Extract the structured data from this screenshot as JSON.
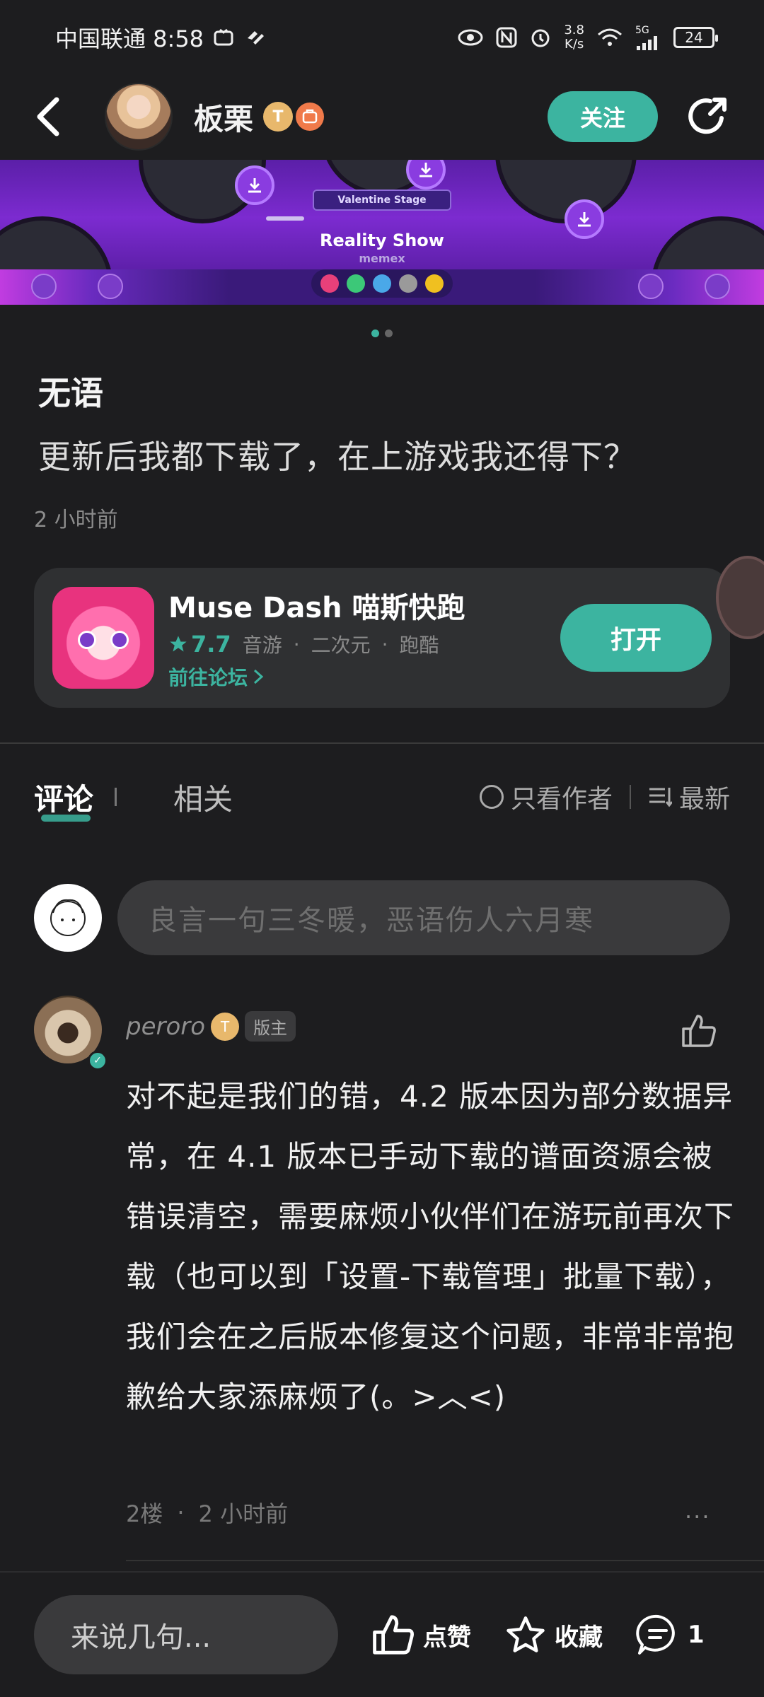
{
  "status_bar": {
    "carrier_time": "中国联通 8:58",
    "net_speed_value": "3.8",
    "net_speed_unit": "K/s",
    "signal_label": "5G",
    "battery": "24"
  },
  "nav": {
    "username": "板栗",
    "level_badge": "T",
    "follow_label": "关注"
  },
  "banner": {
    "stage_label": "Valentine Stage",
    "song_title": "Reality Show",
    "song_artist": "memex"
  },
  "post": {
    "title": "无语",
    "body": "更新后我都下载了，在上游戏我还得下？",
    "time": "2 小时前"
  },
  "app_card": {
    "name": "Muse Dash 喵斯快跑",
    "rating": "7.7",
    "tags": [
      "音游",
      "二次元",
      "跑酷"
    ],
    "forum_link": "前往论坛",
    "open_label": "打开"
  },
  "tabs": {
    "comments": "评论",
    "related": "相关",
    "author_only": "只看作者",
    "sort": "最新"
  },
  "comment_input": {
    "placeholder": "良言一句三冬暖，恶语伤人六月寒"
  },
  "comment": {
    "author": "peroro",
    "level": "T",
    "role": "版主",
    "body": "对不起是我们的错，4.2 版本因为部分数据异常，在 4.1 版本已手动下载的谱面资源会被错误清空，需要麻烦小伙伴们在游玩前再次下载（也可以到「设置-下载管理」批量下载），我们会在之后版本修复这个问题，非常非常抱歉给大家添麻烦了(。>︿<)",
    "floor": "2楼",
    "time": "2 小时前",
    "more": "···"
  },
  "bottom_bar": {
    "input_placeholder": "来说几句...",
    "like_label": "点赞",
    "favorite_label": "收藏",
    "comment_count": "1"
  },
  "colors": {
    "accent": "#3cb4a0",
    "background": "#1d1d1f",
    "card": "#2f3032"
  }
}
